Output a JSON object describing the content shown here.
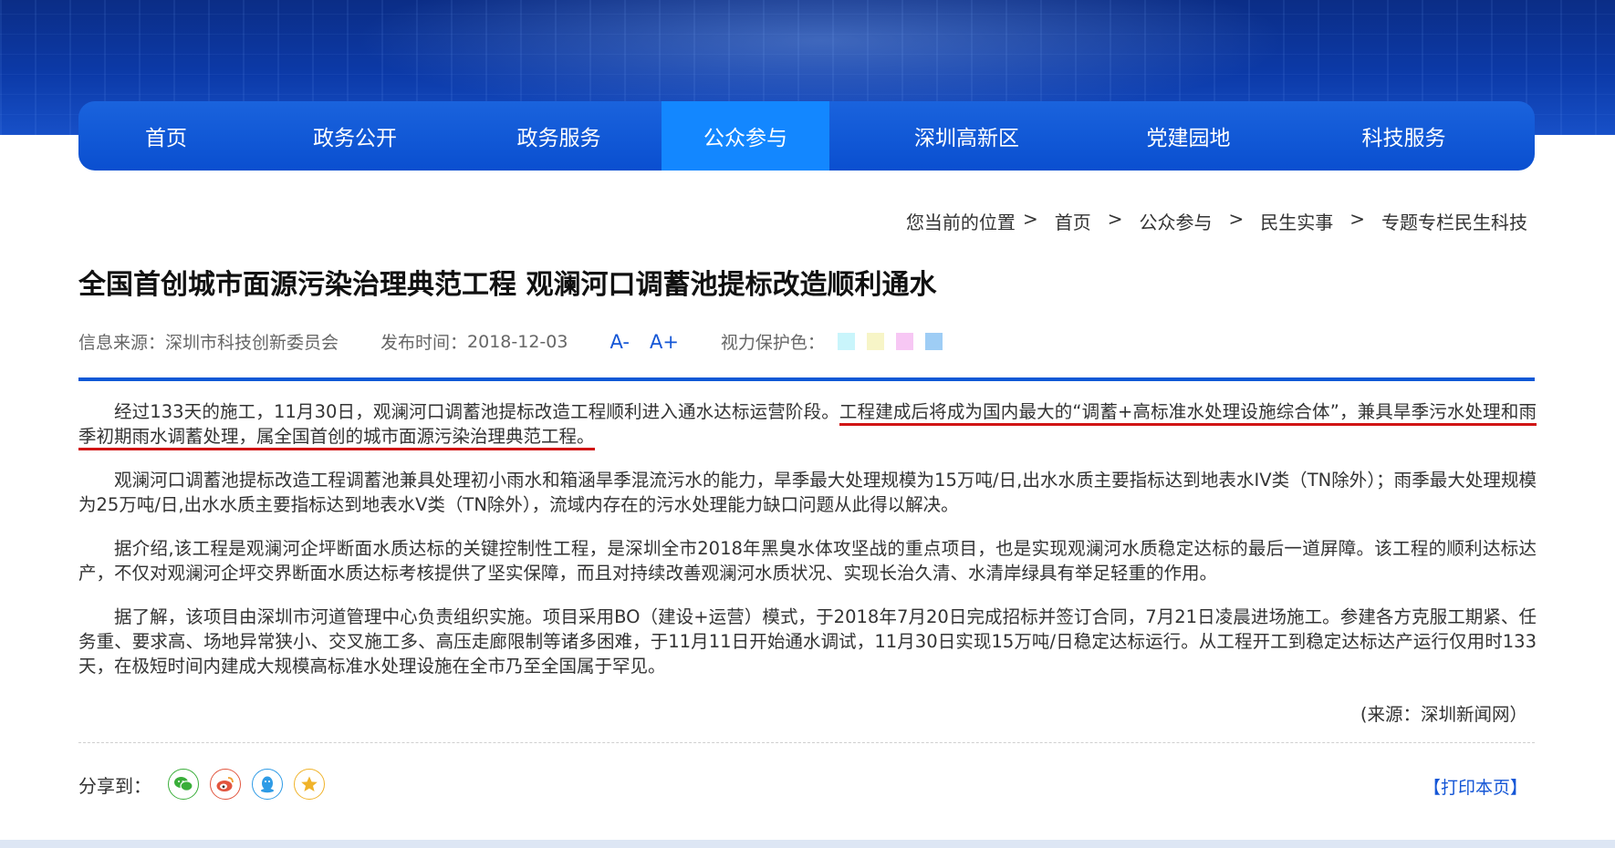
{
  "nav": {
    "items": [
      {
        "label": "首页"
      },
      {
        "label": "政务公开"
      },
      {
        "label": "政务服务"
      },
      {
        "label": "公众参与"
      },
      {
        "label": "深圳高新区"
      },
      {
        "label": "党建园地"
      },
      {
        "label": "科技服务"
      }
    ],
    "active_index": 3
  },
  "breadcrumb": {
    "prefix": "您当前的位置",
    "separator": ">",
    "items": [
      "首页",
      "公众参与",
      "民生实事",
      "专题专栏民生科技"
    ]
  },
  "article": {
    "title": "全国首创城市面源污染治理典范工程 观澜河口调蓄池提标改造顺利通水",
    "source_label": "信息来源：",
    "source_value": "深圳市科技创新委员会",
    "date_label": "发布时间：",
    "date_value": "2018-12-03",
    "font_smaller": "A-",
    "font_larger": "A+",
    "eye_care_label": "视力保护色：",
    "eye_care_colors": [
      "#c9f5fb",
      "#f7f5c7",
      "#f7c7f4",
      "#9ecdf5"
    ],
    "paragraphs": [
      {
        "text_before": "经过133天的施工，11月30日，观澜河口调蓄池提标改造工程顺利进入通水达标运营阶段。",
        "highlight": "工程建成后将成为国内最大的“调蓄+高标准水处理设施综合体”，兼具旱季污水处理和雨季初期雨水调蓄处理，属全国首创的城市面源污染治理典范工程。"
      },
      {
        "text": "观澜河口调蓄池提标改造工程调蓄池兼具处理初小雨水和箱涵旱季混流污水的能力，旱季最大处理规模为15万吨/日,出水水质主要指标达到地表水IV类（TN除外）；雨季最大处理规模为25万吨/日,出水水质主要指标达到地表水V类（TN除外），流域内存在的污水处理能力缺口问题从此得以解决。"
      },
      {
        "text": "据介绍,该工程是观澜河企坪断面水质达标的关键控制性工程，是深圳全市2018年黑臭水体攻坚战的重点项目，也是实现观澜河水质稳定达标的最后一道屏障。该工程的顺利达标达产，不仅对观澜河企坪交界断面水质达标考核提供了坚实保障，而且对持续改善观澜河水质状况、实现长治久清、水清岸绿具有举足轻重的作用。"
      },
      {
        "text": "据了解，该项目由深圳市河道管理中心负责组织实施。项目采用BO（建设+运营）模式，于2018年7月20日完成招标并签订合同，7月21日凌晨进场施工。参建各方克服工期紧、任务重、要求高、场地异常狭小、交叉施工多、高压走廊限制等诸多困难，于11月11日开始通水调试，11月30日实现15万吨/日稳定达标运行。从工程开工到稳定达标达产运行仅用时133天，在极短时间内建成大规模高标准水处理设施在全市乃至全国属于罕见。"
      }
    ],
    "source_note": "(来源：深圳新闻网）"
  },
  "share": {
    "label": "分享到：",
    "icons": [
      {
        "name": "wechat",
        "color": "#3aae3a"
      },
      {
        "name": "weibo",
        "color": "#e2553e"
      },
      {
        "name": "qq",
        "color": "#2e9be6"
      },
      {
        "name": "qzone",
        "color": "#f0b32a"
      }
    ],
    "print_label": "【打印本页】"
  }
}
